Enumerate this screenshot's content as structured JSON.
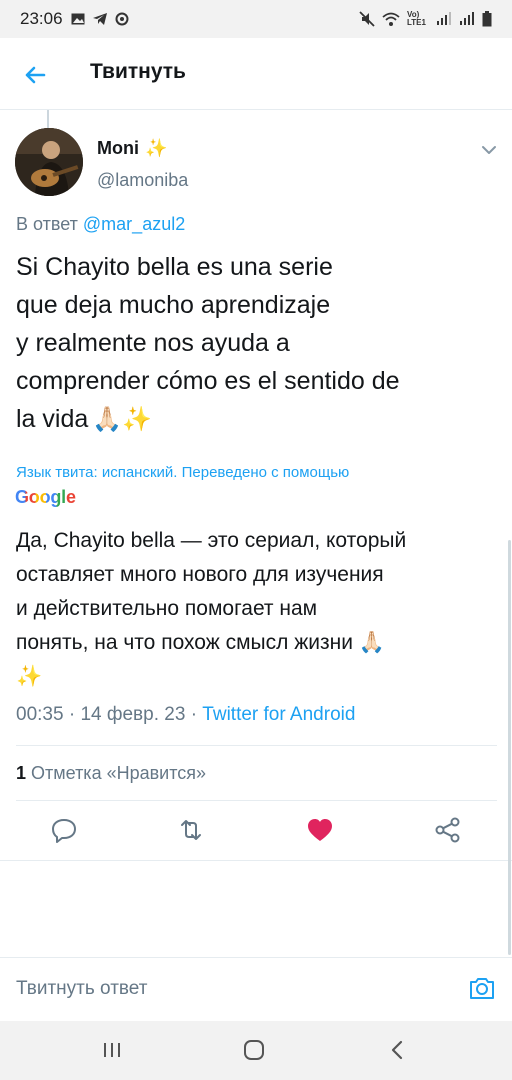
{
  "status": {
    "time": "23:06",
    "network_label": "Vo) LTE1"
  },
  "header": {
    "title": "Твитнуть"
  },
  "tweet": {
    "author_name": "Moni",
    "author_emoji": "✨",
    "handle": "@lamoniba",
    "reply_prefix": "В ответ",
    "reply_mention": "@mar_azul2",
    "text_lines": [
      "Si Chayito bella es una serie",
      "que deja mucho aprendizaje",
      "y realmente nos ayuda a",
      "comprender cómo es el sentido de",
      "la vida"
    ],
    "text_emojis": "🙏🏻✨",
    "translation_note": "Язык твита: испанский. Переведено с помощью",
    "translation_provider": "Google",
    "translated_lines": [
      "Да, Chayito bella — это сериал, который",
      "оставляет много нового для изучения",
      "и действительно помогает нам",
      "понять, на что похож смысл жизни"
    ],
    "translated_emoji_1": "🙏🏻",
    "translated_emoji_2": "✨",
    "time": "00:35",
    "date": "14 февр. 23",
    "separator": "·",
    "source": "Twitter for Android",
    "likes_count": "1",
    "likes_label": "Отметка «Нравится»"
  },
  "compose": {
    "placeholder": "Твитнуть ответ"
  },
  "colors": {
    "accent": "#1da1f2",
    "like": "#e0245e",
    "muted": "#657786"
  },
  "icons": {
    "back": "arrow-left-icon",
    "more": "chevron-down-icon",
    "reply": "reply-icon",
    "retweet": "retweet-icon",
    "like": "heart-icon",
    "share": "share-icon",
    "camera": "camera-icon",
    "recents": "recents-icon",
    "home": "home-icon",
    "nav_back": "nav-back-icon"
  }
}
